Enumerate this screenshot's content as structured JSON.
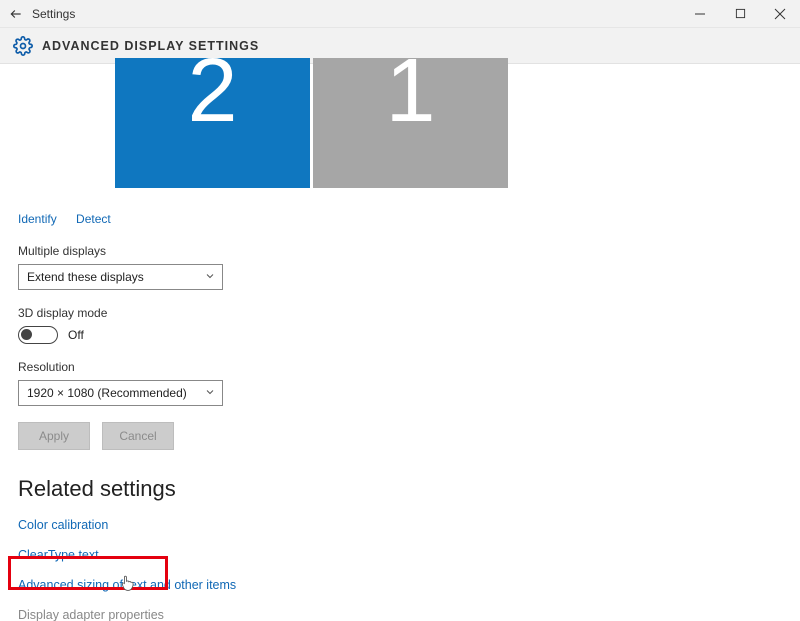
{
  "titlebar": {
    "app_title": "Settings"
  },
  "heading": {
    "page_title": "ADVANCED DISPLAY SETTINGS"
  },
  "monitors": {
    "display2_label": "2",
    "display1_label": "1"
  },
  "actions": {
    "identify": "Identify",
    "detect": "Detect"
  },
  "multiple_displays": {
    "label": "Multiple displays",
    "selected": "Extend these displays"
  },
  "three_d": {
    "label": "3D display mode",
    "state_label": "Off"
  },
  "resolution": {
    "label": "Resolution",
    "selected": "1920 × 1080 (Recommended)"
  },
  "buttons": {
    "apply": "Apply",
    "cancel": "Cancel"
  },
  "related": {
    "heading": "Related settings",
    "links": {
      "color_calibration": "Color calibration",
      "cleartype": "ClearType text",
      "advanced_sizing": "Advanced sizing of text and other items",
      "display_adapter": "Display adapter properties"
    }
  }
}
